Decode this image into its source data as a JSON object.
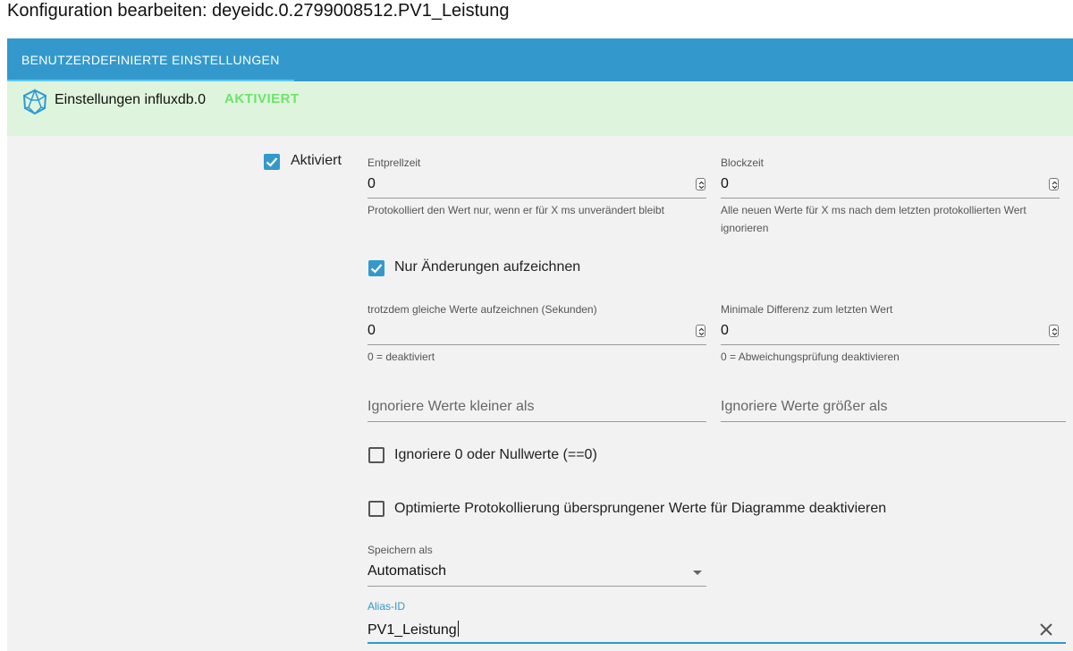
{
  "dialog": {
    "title": "Konfiguration bearbeiten: deyeidc.0.2799008512.PV1_Leistung"
  },
  "tabs": [
    {
      "label": "BENUTZERDEFINIERTE EINSTELLUNGEN",
      "active": true
    }
  ],
  "instance": {
    "icon": "influxdb-icon",
    "label": "Einstellungen influxdb.0",
    "status": "AKTIVIERT"
  },
  "settings": {
    "enabled": {
      "label": "Aktiviert",
      "checked": true
    },
    "debounce": {
      "label": "Entprellzeit",
      "value": "0",
      "help": "Protokolliert den Wert nur, wenn er für X ms unverändert bleibt"
    },
    "blocktime": {
      "label": "Blockzeit",
      "value": "0",
      "help": "Alle neuen Werte für X ms nach dem letzten protokollierten Wert ignorieren"
    },
    "changes_only": {
      "label": "Nur Änderungen aufzeichnen",
      "checked": true
    },
    "change_not_more": {
      "label": "trotzdem gleiche Werte aufzeichnen (Sekunden)",
      "value": "0",
      "help": "0 = deaktiviert"
    },
    "min_diff": {
      "label": "Minimale Differenz zum letzten Wert",
      "value": "0",
      "help": "0 = Abweichungsprüfung deaktivieren"
    },
    "ignore_below": {
      "placeholder": "Ignoriere Werte kleiner als",
      "value": ""
    },
    "ignore_above": {
      "placeholder": "Ignoriere Werte größer als",
      "value": ""
    },
    "ignore_zero": {
      "label": "Ignoriere 0 oder Nullwerte (==0)",
      "checked": false
    },
    "disable_skipped": {
      "label": "Optimierte Protokollierung übersprungener Werte für Diagramme deaktivieren",
      "checked": false
    },
    "store_as": {
      "label": "Speichern als",
      "value": "Automatisch"
    },
    "alias_id": {
      "label": "Alias-ID",
      "value": "PV1_Leistung"
    }
  },
  "colors": {
    "accent": "#3399cc",
    "tab_indicator": "#5ec8f2",
    "status_green": "#6ce36c",
    "header_bg": "#dff4dc",
    "panel_bg": "#f2f2f2"
  }
}
